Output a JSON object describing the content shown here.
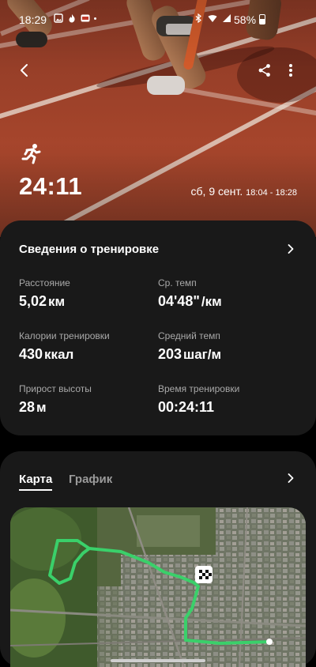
{
  "status_bar": {
    "time": "18:29",
    "battery": "58%"
  },
  "workout": {
    "duration": "24:11",
    "date": "сб, 9 сент.",
    "time_range": "18:04 - 18:28"
  },
  "summary": {
    "title": "Сведения о тренировке",
    "stats": [
      {
        "label": "Расстояние",
        "value": "5,02",
        "unit": "км"
      },
      {
        "label": "Ср. темп",
        "value": "04'48\"",
        "unit": "/км"
      },
      {
        "label": "Калории тренировки",
        "value": "430",
        "unit": "ккал"
      },
      {
        "label": "Средний темп",
        "value": "203",
        "unit": "шаг/м"
      },
      {
        "label": "Прирост высоты",
        "value": "28",
        "unit": "м"
      },
      {
        "label": "Время тренировки",
        "value": "00:24:11",
        "unit": ""
      }
    ]
  },
  "map_card": {
    "tabs": [
      "Карта",
      "График"
    ],
    "active_tab": 0
  },
  "colors": {
    "route": "#3ad06a",
    "card": "#191919",
    "track": "#9a4029"
  },
  "icons": [
    "back-arrow-icon",
    "share-icon",
    "more-options-icon",
    "running-icon",
    "chevron-right-icon",
    "finish-flag-icon"
  ]
}
